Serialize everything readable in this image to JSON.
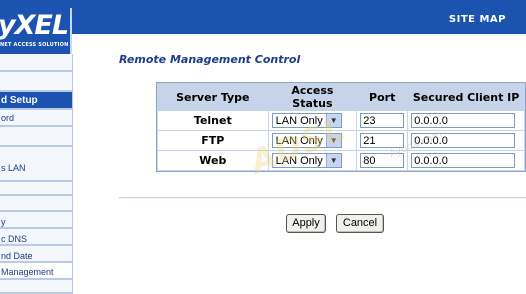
{
  "header": {
    "logo_text": "yXEL",
    "logo_subtext": "NET ACCESS SOLUTION",
    "site_map": "SITE MAP"
  },
  "sidebar": {
    "items": [
      {
        "label": ""
      },
      {
        "label": ""
      },
      {
        "label": "d Setup"
      },
      {
        "label": "ord"
      },
      {
        "label": ""
      },
      {
        "label": "s LAN"
      },
      {
        "label": ""
      },
      {
        "label": ""
      },
      {
        "label": "y"
      },
      {
        "label": "c DNS"
      },
      {
        "label": "nd Date"
      },
      {
        "label": " Management"
      },
      {
        "label": ""
      }
    ]
  },
  "page": {
    "title": "Remote Management Control"
  },
  "table": {
    "headers": [
      "Server Type",
      "Access Status",
      "Port",
      "Secured Client IP"
    ],
    "rows": [
      {
        "type": "Telnet",
        "access": "LAN Only",
        "port": "23",
        "ip": "0.0.0.0"
      },
      {
        "type": "FTP",
        "access": "LAN Only",
        "port": "21",
        "ip": "0.0.0.0"
      },
      {
        "type": "Web",
        "access": "LAN Only",
        "port": "80",
        "ip": "0.0.0.0"
      }
    ]
  },
  "buttons": {
    "apply": "Apply",
    "cancel": "Cancel"
  },
  "watermark": {
    "main": "ADSL",
    "sub": "Ayuda.com"
  }
}
